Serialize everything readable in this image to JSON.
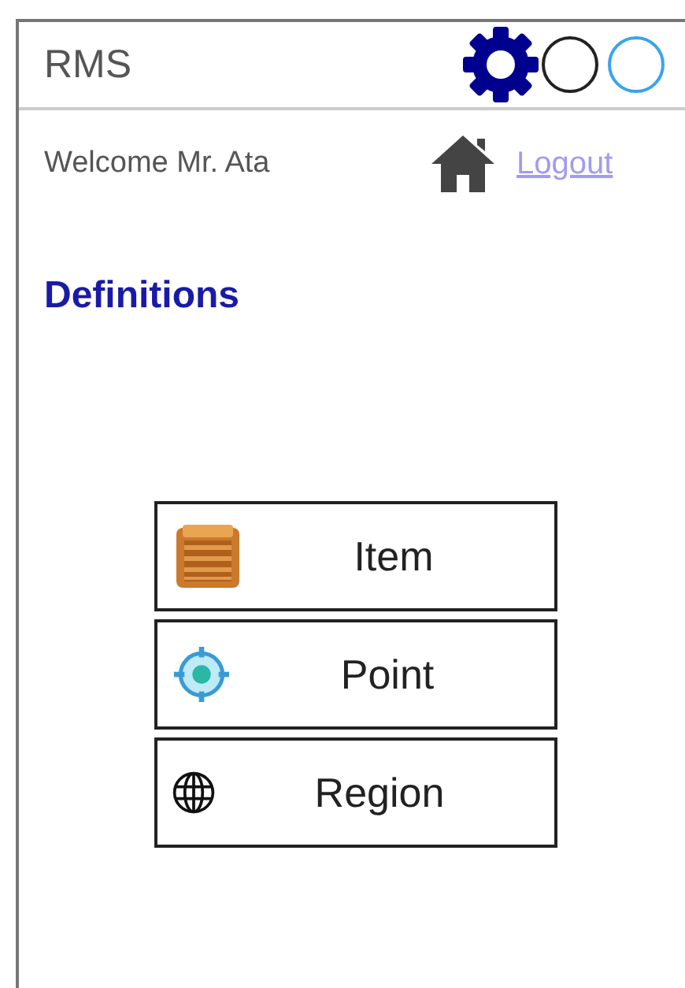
{
  "header": {
    "title": "RMS"
  },
  "user_bar": {
    "welcome": "Welcome Mr. Ata",
    "logout": "Logout"
  },
  "section_title": "Definitions",
  "buttons": [
    {
      "label": "Item"
    },
    {
      "label": "Point"
    },
    {
      "label": "Region"
    }
  ]
}
